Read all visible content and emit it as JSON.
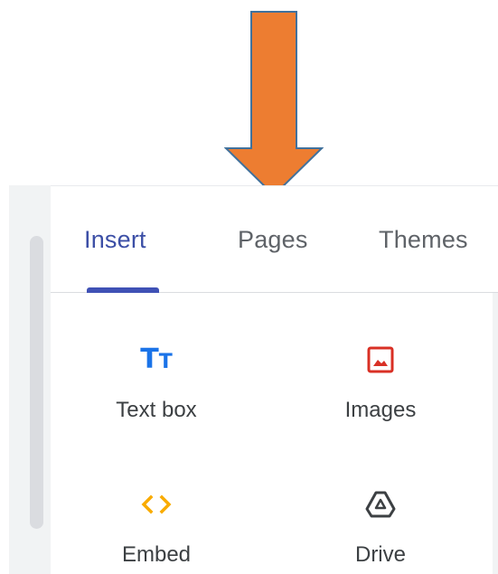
{
  "annotation": {
    "arrow_color": "#ed7d31",
    "arrow_border": "#41719c"
  },
  "tabs": [
    {
      "label": "Insert",
      "active": true
    },
    {
      "label": "Pages",
      "active": false
    },
    {
      "label": "Themes",
      "active": false
    }
  ],
  "insert_items": [
    {
      "label": "Text box",
      "icon": "text-box-icon",
      "color": "#1a73e8"
    },
    {
      "label": "Images",
      "icon": "image-icon",
      "color": "#d93025"
    },
    {
      "label": "Embed",
      "icon": "embed-code-icon",
      "color": "#f9ab00"
    },
    {
      "label": "Drive",
      "icon": "drive-icon",
      "color": "#3c4043"
    }
  ],
  "colors": {
    "active_tab": "#3c4fa6",
    "indicator": "#3f51b5",
    "inactive_tab": "#5f6368"
  }
}
